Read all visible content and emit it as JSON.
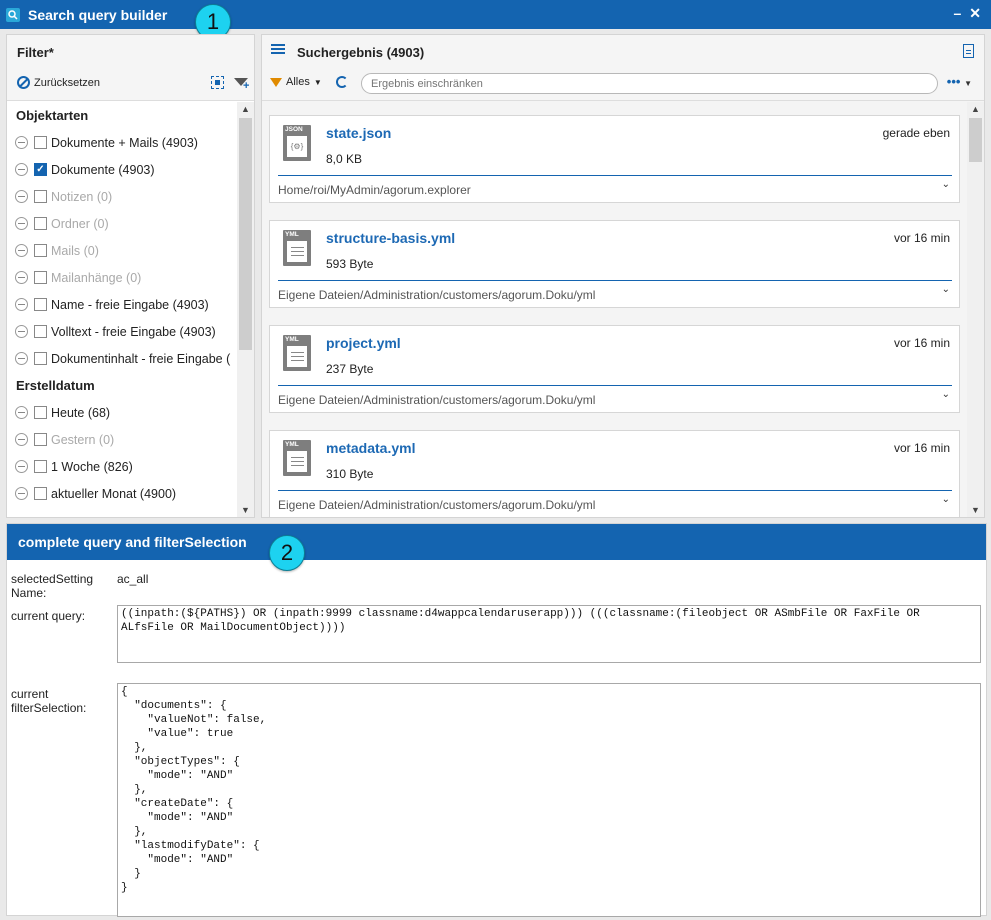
{
  "window": {
    "title": "Search query builder"
  },
  "callouts": {
    "one": "1",
    "two": "2"
  },
  "filter": {
    "title": "Filter*",
    "reset_label": "Zurücksetzen",
    "sections": [
      {
        "title": "Objektarten",
        "items": [
          {
            "label": "Dokumente + Mails (4903)",
            "checked": false,
            "disabled": false
          },
          {
            "label": "Dokumente (4903)",
            "checked": true,
            "disabled": false
          },
          {
            "label": "Notizen (0)",
            "checked": false,
            "disabled": true
          },
          {
            "label": "Ordner (0)",
            "checked": false,
            "disabled": true
          },
          {
            "label": "Mails (0)",
            "checked": false,
            "disabled": true
          },
          {
            "label": "Mailanhänge (0)",
            "checked": false,
            "disabled": true
          },
          {
            "label": "Name - freie Eingabe (4903)",
            "checked": false,
            "disabled": false
          },
          {
            "label": "Volltext - freie Eingabe (4903)",
            "checked": false,
            "disabled": false
          },
          {
            "label": "Dokumentinhalt - freie Eingabe (",
            "checked": false,
            "disabled": false
          }
        ]
      },
      {
        "title": "Erstelldatum",
        "items": [
          {
            "label": "Heute (68)",
            "checked": false,
            "disabled": false
          },
          {
            "label": "Gestern (0)",
            "checked": false,
            "disabled": true
          },
          {
            "label": "1 Woche (826)",
            "checked": false,
            "disabled": false
          },
          {
            "label": "aktueller Monat (4900)",
            "checked": false,
            "disabled": false
          }
        ]
      }
    ]
  },
  "results": {
    "title": "Suchergebnis (4903)",
    "filter_label": "Alles",
    "search_placeholder": "Ergebnis einschränken",
    "more_label": "•••",
    "items": [
      {
        "name": "state.json",
        "type": "JSON",
        "size": "8,0 KB",
        "time": "gerade eben",
        "path": "Home/roi/MyAdmin/agorum.explorer"
      },
      {
        "name": "structure-basis.yml",
        "type": "YML",
        "size": "593 Byte",
        "time": "vor 16 min",
        "path": "Eigene Dateien/Administration/customers/agorum.Doku/yml"
      },
      {
        "name": "project.yml",
        "type": "YML",
        "size": "237 Byte",
        "time": "vor 16 min",
        "path": "Eigene Dateien/Administration/customers/agorum.Doku/yml"
      },
      {
        "name": "metadata.yml",
        "type": "YML",
        "size": "310 Byte",
        "time": "vor 16 min",
        "path": "Eigene Dateien/Administration/customers/agorum.Doku/yml"
      }
    ]
  },
  "query_panel": {
    "title": "complete query and filterSelection",
    "setting_label": "selectedSetting Name:",
    "setting_value": "ac_all",
    "query_label": "current query:",
    "query_value": "((inpath:(${PATHS}) OR (inpath:9999 classname:d4wappcalendaruserapp))) (((classname:(fileobject OR ASmbFile OR FaxFile OR\nALfsFile OR MailDocumentObject))))",
    "selection_label": "current filterSelection:",
    "selection_value": "{\n  \"documents\": {\n    \"valueNot\": false,\n    \"value\": true\n  },\n  \"objectTypes\": {\n    \"mode\": \"AND\"\n  },\n  \"createDate\": {\n    \"mode\": \"AND\"\n  },\n  \"lastmodifyDate\": {\n    \"mode\": \"AND\"\n  }\n}"
  },
  "colors": {
    "accent": "#1464b0",
    "link": "#1d69b4",
    "callout": "#1dd2f0"
  }
}
